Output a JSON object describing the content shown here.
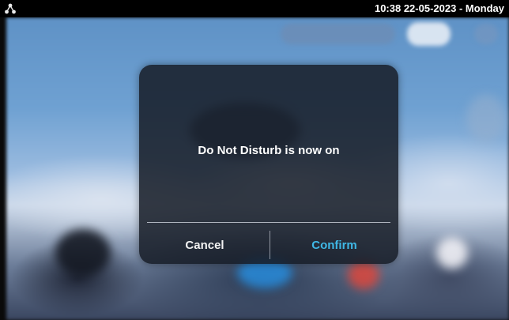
{
  "status_bar": {
    "icon": "network-icon",
    "clock_text": "10:38  22-05-2023 - Monday"
  },
  "dialog": {
    "message": "Do Not Disturb is now on",
    "cancel_label": "Cancel",
    "confirm_label": "Confirm"
  },
  "colors": {
    "confirm_accent": "#3fb8e6",
    "dialog_bg": "#161c26",
    "status_bar_bg": "#000000"
  }
}
